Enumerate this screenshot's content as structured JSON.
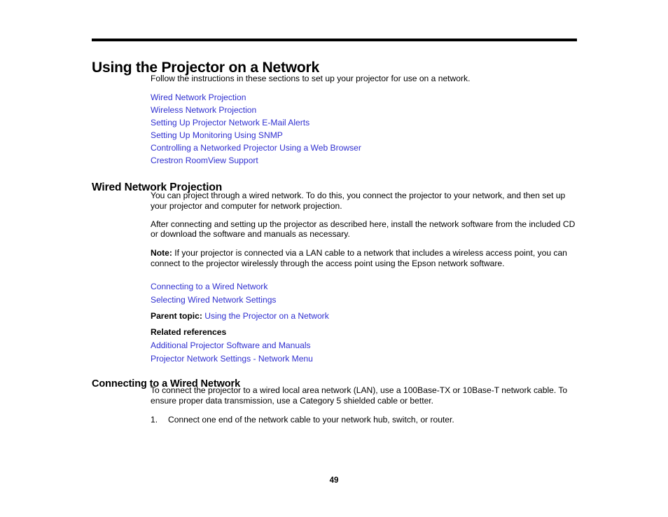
{
  "document": {
    "page_number": "49",
    "link_color": "#2f2fd0",
    "text_color": "#000000",
    "background_color": "#ffffff"
  },
  "chapter": {
    "title": "Using the Projector on a Network",
    "intro": "Follow the instructions in these sections to set up your projector for use on a network.",
    "toc_links": [
      {
        "label": "Wired Network Projection"
      },
      {
        "label": "Wireless Network Projection"
      },
      {
        "label": "Setting Up Projector Network E-Mail Alerts"
      },
      {
        "label": "Setting Up Monitoring Using SNMP"
      },
      {
        "label": "Controlling a Networked Projector Using a Web Browser"
      },
      {
        "label": "Crestron RoomView Support"
      }
    ]
  },
  "wired_section": {
    "heading": "Wired Network Projection",
    "paragraph_1": "You can project through a wired network. To do this, you connect the projector to your network, and then set up your projector and computer for network projection.",
    "paragraph_2": "After connecting and setting up the projector as described here, install the network software from the included CD or download the software and manuals as necessary.",
    "note_label": "Note:",
    "note_text": " If your projector is connected via a LAN cable to a network that includes a wireless access point, you can connect to the projector wirelessly through the access point using the Epson network software.",
    "sub_links": [
      {
        "label": "Connecting to a Wired Network"
      },
      {
        "label": "Selecting Wired Network Settings"
      }
    ],
    "parent_topic_label": "Parent topic:",
    "parent_topic_link": "Using the Projector on a Network",
    "related_references_heading": "Related references",
    "related_references": [
      {
        "label": "Additional Projector Software and Manuals"
      },
      {
        "label": "Projector Network Settings - Network Menu"
      }
    ]
  },
  "connecting_section": {
    "heading": "Connecting to a Wired Network",
    "paragraph_1": "To connect the projector to a wired local area network (LAN), use a 100Base-TX or 10Base-T network cable. To ensure proper data transmission, use a Category 5 shielded cable or better.",
    "steps": [
      {
        "number": "1.",
        "text": "Connect one end of the network cable to your network hub, switch, or router."
      }
    ]
  }
}
